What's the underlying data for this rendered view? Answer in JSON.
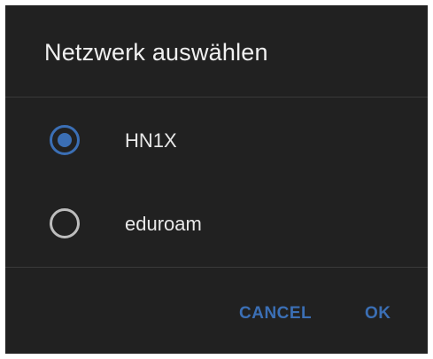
{
  "dialog": {
    "title": "Netzwerk auswählen",
    "options": [
      {
        "label": "HN1X",
        "selected": true
      },
      {
        "label": "eduroam",
        "selected": false
      }
    ],
    "buttons": {
      "cancel": "CANCEL",
      "ok": "OK"
    }
  },
  "colors": {
    "background": "#212121",
    "accent": "#3b6fb5",
    "text": "#e8e8e8",
    "divider": "#3a3a3a"
  }
}
